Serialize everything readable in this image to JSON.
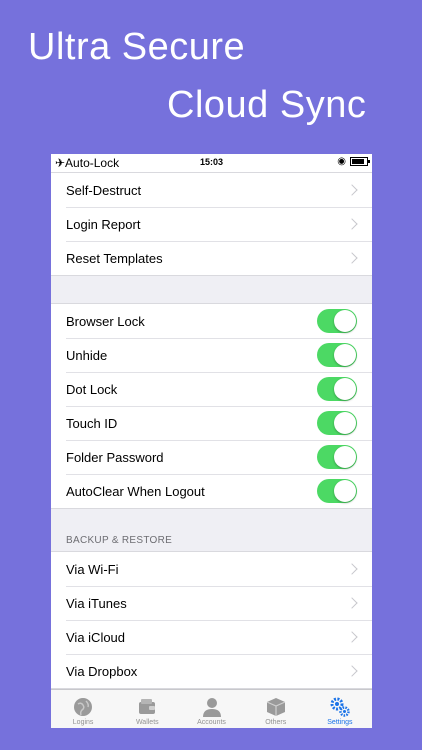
{
  "headline": {
    "line1": "Ultra Secure",
    "line2": "Cloud Sync"
  },
  "status_bar": {
    "left": "✈Auto-Lock",
    "time": "15:03"
  },
  "group1": [
    {
      "label": "Self-Destruct"
    },
    {
      "label": "Login Report"
    },
    {
      "label": "Reset Templates"
    }
  ],
  "group2": [
    {
      "label": "Browser Lock",
      "on": true
    },
    {
      "label": "Unhide",
      "on": true
    },
    {
      "label": "Dot Lock",
      "on": true
    },
    {
      "label": "Touch ID",
      "on": true
    },
    {
      "label": "Folder Password",
      "on": true
    },
    {
      "label": "AutoClear When Logout",
      "on": true
    }
  ],
  "backup_header": "BACKUP & RESTORE",
  "group3": [
    {
      "label": "Via Wi-Fi"
    },
    {
      "label": "Via iTunes"
    },
    {
      "label": "Via iCloud"
    },
    {
      "label": "Via Dropbox"
    }
  ],
  "tabs": [
    {
      "label": "Logins",
      "icon": "globe-icon"
    },
    {
      "label": "Wallets",
      "icon": "wallet-icon"
    },
    {
      "label": "Accounts",
      "icon": "person-icon"
    },
    {
      "label": "Others",
      "icon": "box-icon"
    },
    {
      "label": "Settings",
      "icon": "gears-icon",
      "active": true
    }
  ],
  "colors": {
    "background": "#7671dc",
    "toggle_on": "#4cd964",
    "tab_active": "#1a73e8"
  }
}
